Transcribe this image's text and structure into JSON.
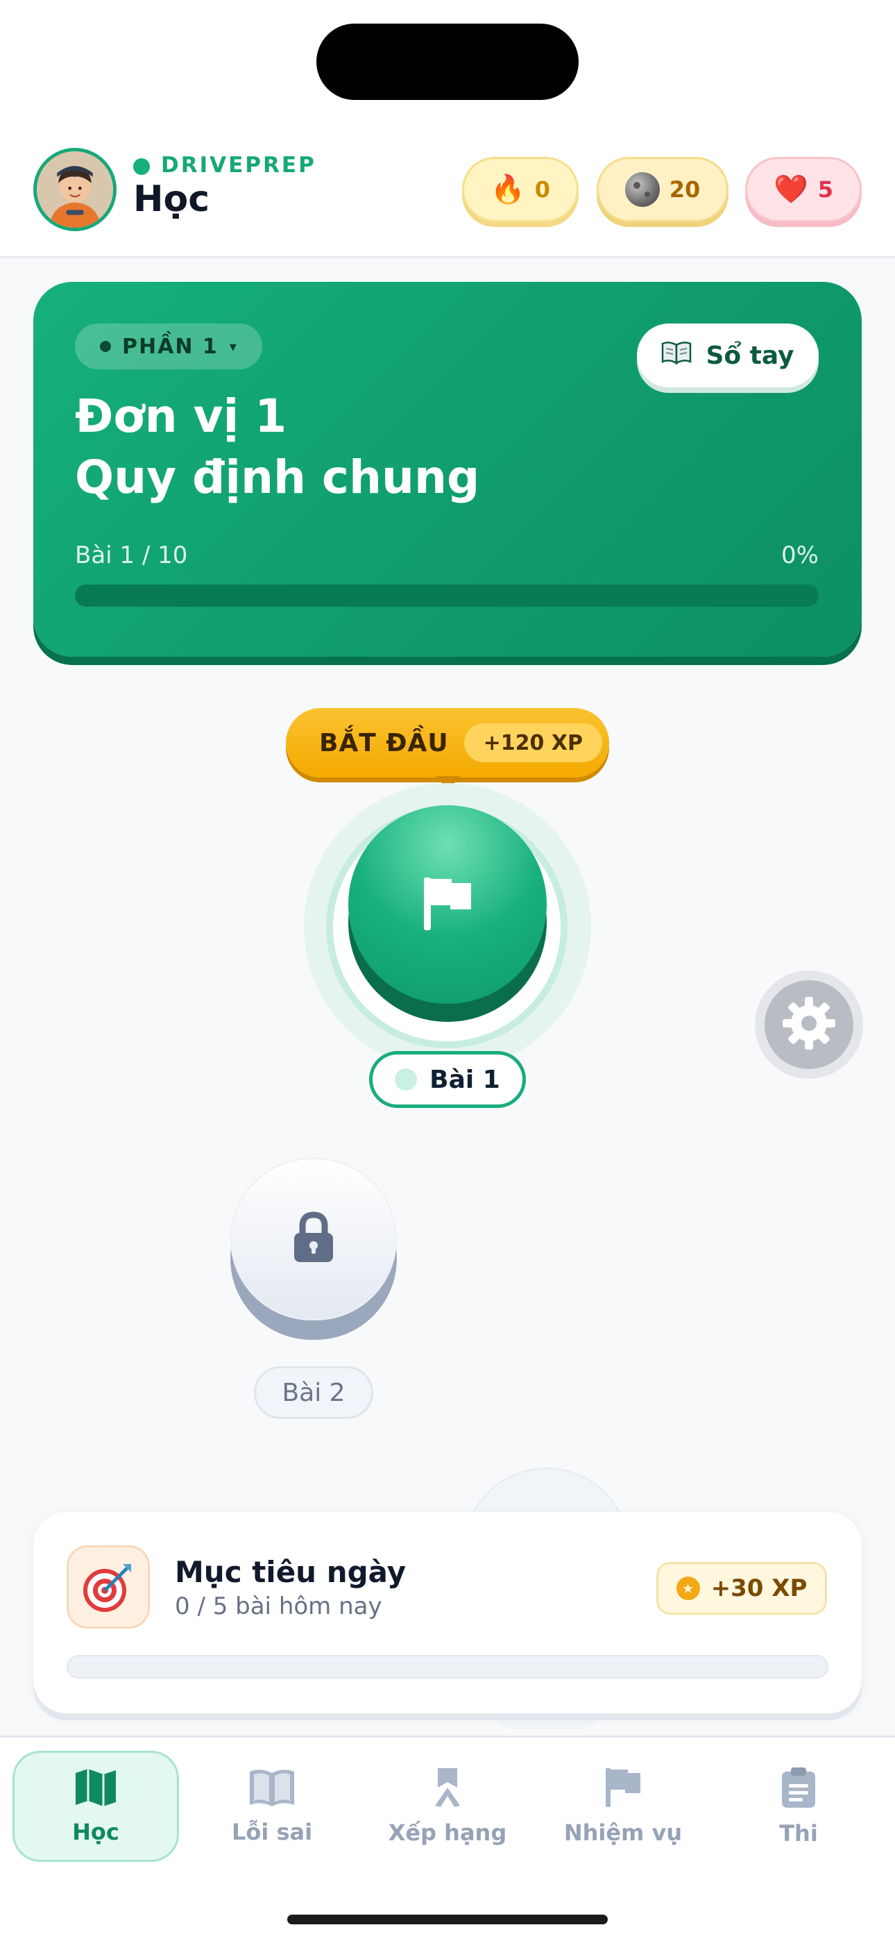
{
  "app": {
    "brand": "DRIVEPREP",
    "page_title": "Học"
  },
  "stats": {
    "streak": "0",
    "gems": "20",
    "hearts": "5"
  },
  "unit": {
    "section_label": "PHẦN 1",
    "section_caret": "▾",
    "notebook_label": "Sổ tay",
    "title": "Đơn vị 1",
    "subtitle": "Quy định chung",
    "progress_label": "Bài 1 / 10",
    "progress_percent_label": "0%",
    "progress": 0
  },
  "path": {
    "start_label": "BẮT ĐẦU",
    "start_xp": "+120 XP",
    "lesson1_label": "Bài 1",
    "lesson2_label": "Bài 2"
  },
  "daily_goal": {
    "title": "Mục tiêu ngày",
    "subtitle": "0 / 5 bài hôm nay",
    "reward": "+30 XP",
    "progress": 0
  },
  "nav": {
    "items": [
      {
        "label": "Học",
        "icon": "map-icon",
        "active": true
      },
      {
        "label": "Lỗi sai",
        "icon": "book-icon",
        "active": false
      },
      {
        "label": "Xếp hạng",
        "icon": "leaderboard-icon",
        "active": false
      },
      {
        "label": "Nhiệm vụ",
        "icon": "flag-icon",
        "active": false
      },
      {
        "label": "Thi",
        "icon": "clipboard-icon",
        "active": false
      }
    ]
  },
  "colors": {
    "primary": "#16b07a",
    "primary_dark": "#08714d",
    "accent": "#f4a900",
    "heart": "#e1324d",
    "muted": "#96a2b6"
  }
}
